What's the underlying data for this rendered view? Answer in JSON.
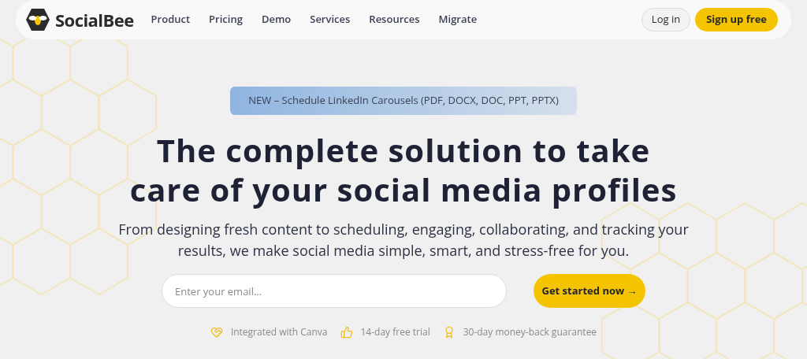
{
  "brand": {
    "name": "SocialBee"
  },
  "nav": {
    "items": [
      "Product",
      "Pricing",
      "Demo",
      "Services",
      "Resources",
      "Migrate"
    ],
    "login": "Log in",
    "signup": "Sign up free"
  },
  "announcement": "NEW – Schedule LinkedIn Carousels (PDF, DOCX, DOC, PPT, PPTX)",
  "headline": [
    "The complete solution to take",
    "care of your social media profiles"
  ],
  "subtitle": "From designing fresh content to scheduling, engaging, collaborating, and tracking your results, we make social media simple, smart, and stress-free for you.",
  "signup_form": {
    "placeholder": "Enter your email...",
    "button": "Get started now →"
  },
  "features": [
    "Integrated with Canva",
    "14-day free trial",
    "30-day money-back guarantee"
  ]
}
